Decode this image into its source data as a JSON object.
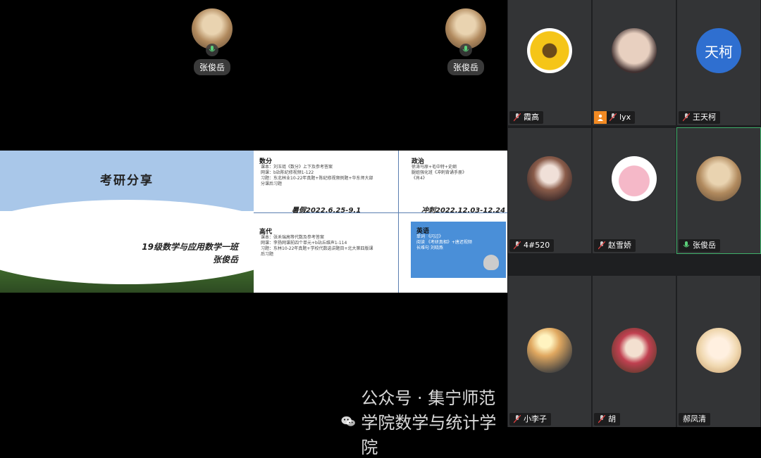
{
  "presenters": [
    {
      "name": "张俊岳"
    },
    {
      "name": "张俊岳"
    }
  ],
  "slide_left": {
    "title": "考研分享",
    "class_line": "19级数学与应用数学一班",
    "speaker": "张俊岳"
  },
  "slide_right": {
    "math": {
      "heading": "数分",
      "lines": [
        "课本：刘玉琏《数分》上下及参考答案",
        "网课：b站陈纪修视频1-122",
        "习题：东北林业10-22年真题+陈纪修视频例题+华东师大部",
        "分课后习题"
      ]
    },
    "politics": {
      "heading": "政治",
      "lines": [
        "徐涛马原+毛中特+史纲",
        "腿姐强化班《冲刺背诵手册》",
        "《肖4》"
      ]
    },
    "algebra": {
      "heading": "高代",
      "lines": [
        "课本：张禾瑞高等代数及参考答案",
        "网课：李扬网课前四个单元+b站丘维声1-114",
        "习题：东林10-22年真题+学校代数选讲题目+北大第四版课",
        "后习题"
      ]
    },
    "english": {
      "heading": "英语",
      "lines": [
        "单词 《闪过》",
        "阅读 《考研真相》+唐迟视频",
        "长难句 刘晓燕"
      ]
    },
    "summer": "暑假2022.6.25-9.1",
    "sprint": "冲刺2022.12.03-12.24"
  },
  "participants": [
    {
      "name": "霞高",
      "avatar": "sunflower-avatar",
      "color": "#f5c518"
    },
    {
      "name": "lyx",
      "avatar": "face-avatar",
      "color": "#d9c2b0",
      "has_user_badge": true
    },
    {
      "name": "王天柯",
      "avatar_text": "天柯",
      "color": "#2f6fd0"
    },
    {
      "name": "4#520",
      "avatar": "anime-avatar",
      "color": "#8a5c4a"
    },
    {
      "name": "赵雪娇",
      "avatar": "pig-avatar",
      "color": "#f5b8c8"
    },
    {
      "name": "张俊岳",
      "avatar": "dog-avatar",
      "color": "#b18a5e",
      "active": true
    },
    {
      "name": "小李子",
      "avatar": "sunset-avatar",
      "color": "#e0a860"
    },
    {
      "name": "胡",
      "avatar": "opera-avatar",
      "color": "#c04050"
    },
    {
      "name": "郝凤清",
      "avatar": "anime-girl-avatar",
      "color": "#f0d8b0"
    }
  ],
  "watermark": "公众号 · 集宁师范学院数学与统计学院"
}
